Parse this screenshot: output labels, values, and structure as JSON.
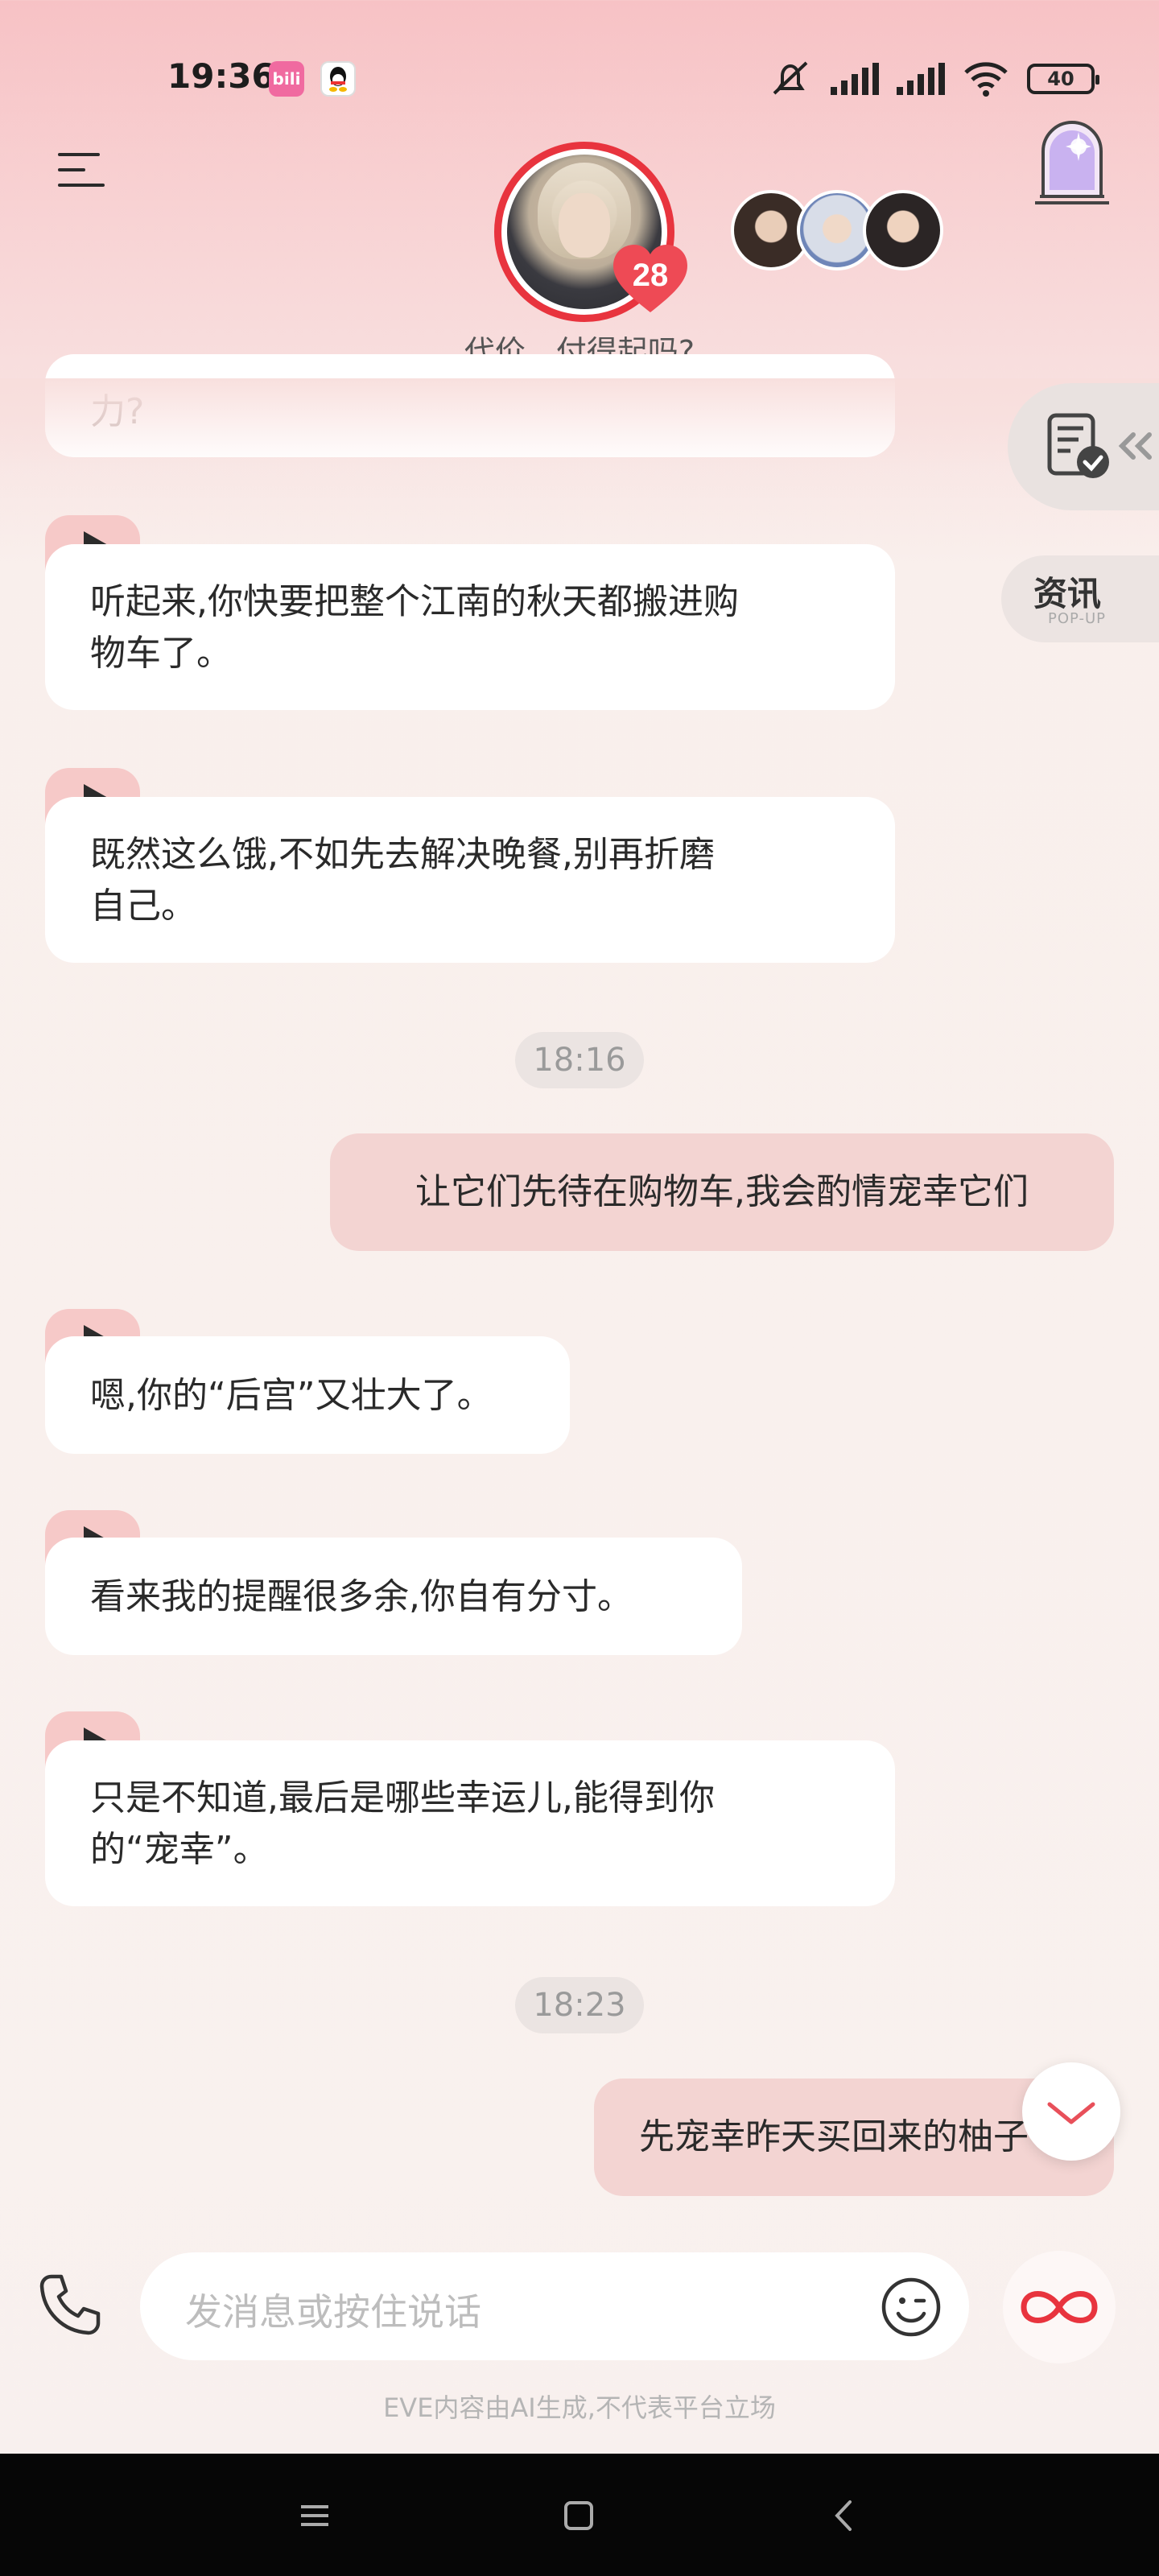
{
  "status_bar": {
    "time": "19:36",
    "bili_badge": "bili",
    "battery": "40"
  },
  "header": {
    "subtitle": "代价…付得起吗?",
    "affinity": "28"
  },
  "side_buttons": {
    "news_label": "资讯",
    "news_sub": "POP-UP"
  },
  "chat": {
    "partial_message": "力?",
    "ai_messages": [
      {
        "line1": "听起来,你快要把整个江南的秋天都搬进购",
        "line2": "物车了。"
      },
      {
        "line1": "既然这么饿,不如先去解决晚餐,别再折磨",
        "line2": "自己。"
      },
      {
        "line1": "嗯,你的“后宫”又壮大了。",
        "line2": ""
      },
      {
        "line1": "看来我的提醒很多余,你自有分寸。",
        "line2": ""
      },
      {
        "line1": "只是不知道,最后是哪些幸运儿,能得到你",
        "line2": "的“宠幸”。"
      }
    ],
    "timestamps": [
      "18:16",
      "18:23"
    ],
    "user_messages": [
      "让它们先待在购物车,我会酌情宠幸它们",
      "先宠幸昨天买回来的柚子"
    ]
  },
  "input": {
    "placeholder": "发消息或按住说话"
  },
  "disclaimer": "EVE内容由AI生成,不代表平台立场",
  "colors": {
    "accent": "#e8343e",
    "user_bubble": "#f3d4d2",
    "play_tab": "#f6c9c8"
  }
}
